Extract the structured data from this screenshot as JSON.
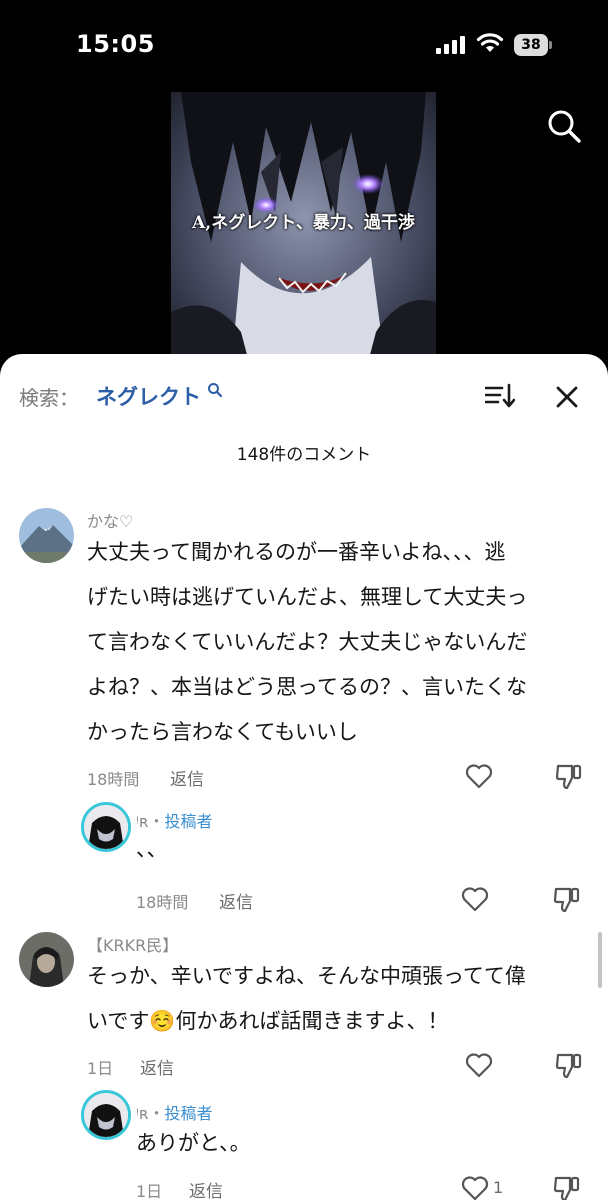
{
  "status": {
    "time": "15:05",
    "battery": "38"
  },
  "video": {
    "caption": "A,ネグレクト、暴力、過干渉"
  },
  "sheet": {
    "search_label": "検索：",
    "search_term": "ネグレクト",
    "comment_count": "148件のコメント"
  },
  "comments": [
    {
      "user": "かな♡",
      "text_lines": [
        "大丈夫って聞かれるのが一番辛いよね、、、逃",
        "げたい時は逃げていんだよ、無理して大丈夫っ",
        "て言わなくていいんだよ？大丈夫じゃないんだ",
        "よね？、本当はどう思ってるの？、言いたくな",
        "かったら言わなくてもいいし"
      ],
      "time": "18時間",
      "reply": "返信",
      "replies": [
        {
          "user": "ᵎ ʀ・投稿者",
          "user_prefix": "ᵎʀ・",
          "badge": "投稿者",
          "text": "、、",
          "time": "18時間",
          "reply": "返信"
        }
      ]
    },
    {
      "user": "【KRKR民】",
      "text_lines": [
        "そっか、辛いですよね、そんな中頑張ってて偉",
        "いです☺️何かあれば話聞きますよ、！"
      ],
      "time": "1日",
      "reply": "返信",
      "replies": [
        {
          "user": "ᵎ ʀ・投稿者",
          "user_prefix": "ᵎʀ・",
          "badge": "投稿者",
          "text": "ありがと、。",
          "time": "1日",
          "reply": "返信",
          "likes": "1"
        }
      ]
    }
  ],
  "icons": {
    "search": "search-icon",
    "sort": "sort-icon",
    "close": "close-icon",
    "heart": "heart-icon",
    "dislike": "thumbs-down-icon"
  },
  "colors": {
    "accent": "#2c5fa8",
    "author_badge": "#3b8fd1"
  }
}
